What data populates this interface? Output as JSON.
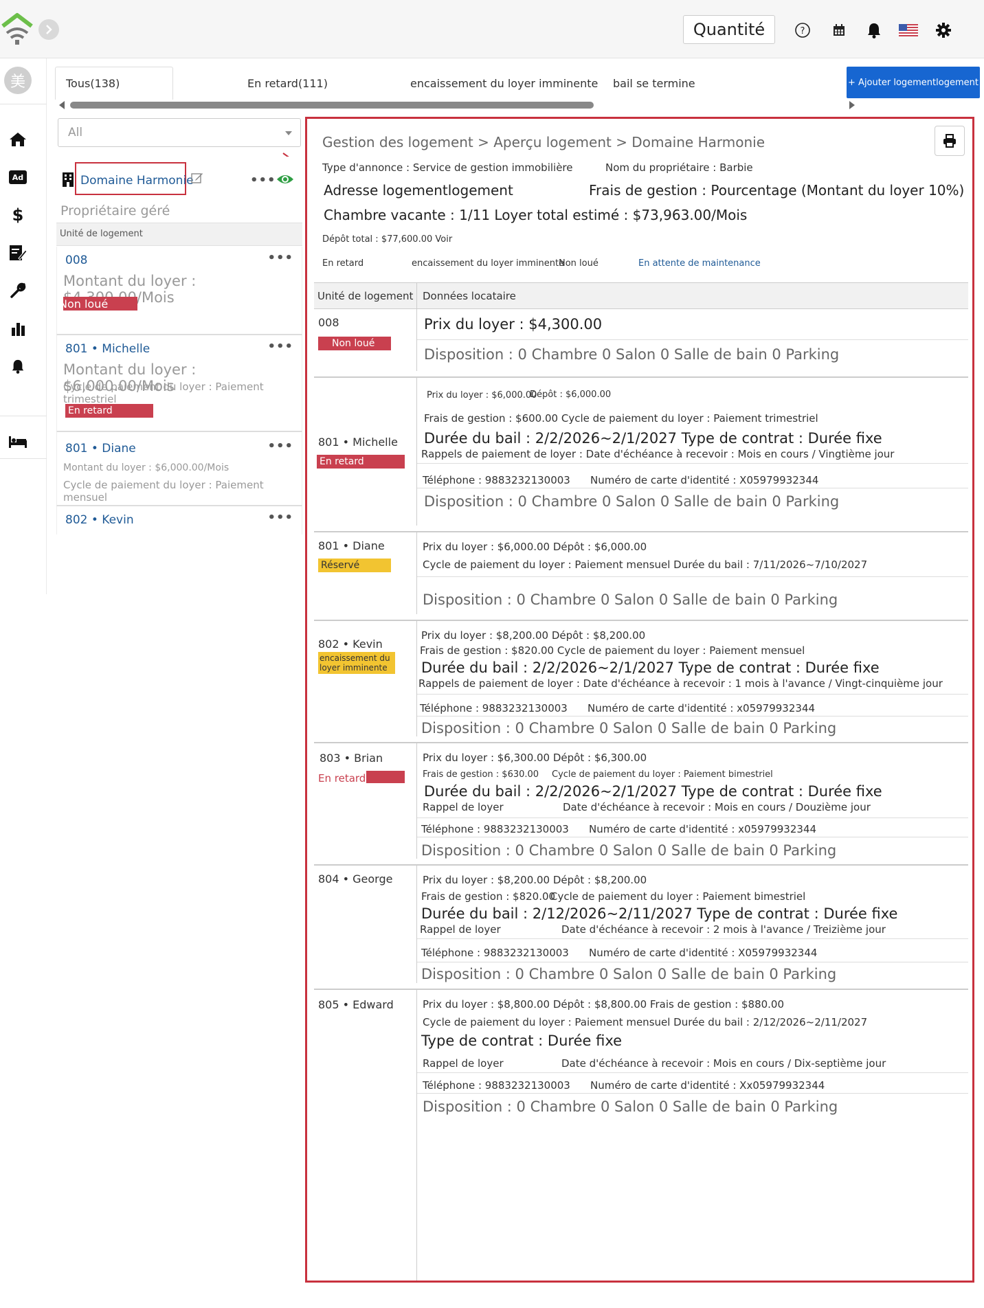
{
  "header": {
    "quantity_label": "Quantité",
    "icons": [
      "logo-house-wifi-icon",
      "chevron-right-icon",
      "help-circle-icon",
      "calendar-icon",
      "bell-icon",
      "us-flag-icon",
      "gear-icon"
    ]
  },
  "sidebar": {
    "avatar_text": "美",
    "icons": [
      "home-icon",
      "ad-icon",
      "dollar-icon",
      "contract-edit-icon",
      "wrench-icon",
      "bar-chart-icon",
      "bell-icon",
      "bed-icon"
    ]
  },
  "tabs": [
    "Tous(138)",
    "En retard(111)",
    "encaissement du loyer imminente",
    "bail se termine"
  ],
  "add_button_label": "+ Ajouter logementlogement",
  "filter_select": {
    "value": "All"
  },
  "property": {
    "name": "Domaine Harmonie",
    "managed_label": "Propriétaire géré",
    "units_header": "Unité de logement"
  },
  "left_units": [
    {
      "title": "008",
      "line1": "Montant du loyer : $4,300.00/Mois",
      "status": "Non loué"
    },
    {
      "title": "801 • Michelle",
      "line1": "Montant du loyer : $6,000.00/Mois",
      "line2": "Cycle de paiement du loyer : Paiement trimestriel",
      "status": "En retard"
    },
    {
      "title": "801 • Diane",
      "line1": "Montant du loyer : $6,000.00/Mois",
      "line2": "Cycle de paiement du loyer : Paiement mensuel"
    },
    {
      "title": "802 • Kevin"
    }
  ],
  "detail": {
    "breadcrumb": "Gestion des logement > Aperçu logement > Domaine Harmonie",
    "listing_type": "Type d'annonce : Service de gestion immobilière",
    "owner_name": "Nom du propriétaire : Barbie",
    "address": "Adresse logementlogement",
    "management_fee": "Frais de gestion : Pourcentage (Montant du loyer 10%)",
    "vacancy": "Chambre vacante : 1/11 Loyer total estimé : $73,963.00/Mois",
    "deposit_total": "Dépôt total : $77,600.00 Voir",
    "legend": [
      "En retard",
      "encaissement du loyer imminente",
      "Non loué",
      "En attente de maintenance"
    ],
    "col_unit": "Unité de logement",
    "col_tenant": "Données locataire"
  },
  "rows": [
    {
      "unit": "008",
      "status": "Non loué",
      "l1": "Prix du loyer : $4,300.00",
      "disp": "Disposition : 0 Chambre 0 Salon 0 Salle de bain 0 Parking"
    },
    {
      "unit": "801 • Michelle",
      "status": "En retard",
      "l1": "Prix du loyer : $6,000.00",
      "l1b": "Dépôt : $6,000.00",
      "l2": "Frais de gestion : $600.00 Cycle de paiement du loyer : Paiement trimestriel",
      "l3": "Durée du bail : 2/2/2026~2/1/2027 Type de contrat : Durée fixe",
      "l4": "Rappels de paiement de loyer : Date d'échéance à recevoir : Mois en cours / Vingtième jour",
      "phone": "Téléphone : 9883232130003",
      "id": "Numéro de carte d'identité : X05979932344",
      "disp": "Disposition : 0 Chambre 0 Salon 0 Salle de bain 0 Parking"
    },
    {
      "unit": "801 • Diane",
      "status": "Réservé",
      "l1": "Prix du loyer : $6,000.00 Dépôt : $6,000.00",
      "l2": "Cycle de paiement du loyer : Paiement mensuel Durée du bail : 7/11/2026~7/10/2027",
      "disp": "Disposition : 0 Chambre 0 Salon 0 Salle de bain 0 Parking"
    },
    {
      "unit": "802 • Kevin",
      "status": "encaissement du loyer imminente",
      "l1": "Prix du loyer : $8,200.00 Dépôt : $8,200.00",
      "l2": "Frais de gestion : $820.00 Cycle de paiement du loyer : Paiement mensuel",
      "l3": "Durée du bail : 2/2/2026~2/1/2027 Type de contrat : Durée fixe",
      "l4": "Rappels de paiement de loyer : Date d'échéance à recevoir : 1 mois à l'avance / Vingt-cinquième jour",
      "phone": "Téléphone : 9883232130003",
      "id": "Numéro de carte d'identité : x05979932344",
      "disp": "Disposition : 0 Chambre 0 Salon 0 Salle de bain 0 Parking"
    },
    {
      "unit": "803 • Brian",
      "status": "En retard",
      "l1": "Prix du loyer : $6,300.00 Dépôt : $6,300.00",
      "l2": "Frais de gestion : $630.00",
      "l2b": "Cycle de paiement du loyer : Paiement bimestriel",
      "l3": "Durée du bail : 2/2/2026~2/1/2027 Type de contrat : Durée fixe",
      "l4": "Rappel de loyer",
      "l4b": "Date d'échéance à recevoir : Mois en cours / Douzième jour",
      "phone": "Téléphone : 9883232130003",
      "id": "Numéro de carte d'identité : x05979932344",
      "disp": "Disposition : 0 Chambre 0 Salon 0 Salle de bain 0 Parking"
    },
    {
      "unit": "804 • George",
      "l1": "Prix du loyer : $8,200.00 Dépôt : $8,200.00",
      "l2": "Frais de gestion : $820.00",
      "l2b": "Cycle de paiement du loyer : Paiement bimestriel",
      "l3": "Durée du bail : 2/12/2026~2/11/2027 Type de contrat : Durée fixe",
      "l4": "Rappel de loyer",
      "l4b": "Date d'échéance à recevoir : 2 mois à l'avance / Treizième jour",
      "phone": "Téléphone : 9883232130003",
      "id": "Numéro de carte d'identité : X05979932344",
      "disp": "Disposition : 0 Chambre 0 Salon 0 Salle de bain 0 Parking"
    },
    {
      "unit": "805 • Edward",
      "l1": "Prix du loyer : $8,800.00 Dépôt : $8,800.00 Frais de gestion : $880.00",
      "l2": "Cycle de paiement du loyer : Paiement mensuel Durée du bail : 2/12/2026~2/11/2027",
      "l3": "Type de contrat : Durée fixe",
      "l4": "Rappel de loyer",
      "l4b": "Date d'échéance à recevoir : Mois en cours / Dix-septième jour",
      "phone": "Téléphone : 9883232130003",
      "id": "Numéro de carte d'identité : Xx05979932344",
      "disp": "Disposition : 0 Chambre 0 Salon 0 Salle de bain 0 Parking"
    }
  ],
  "colors": {
    "accent": "#1766d1",
    "danger": "#c9404f",
    "warning": "#f2c431",
    "highlight_border": "#c8313e",
    "logo_green": "#6cbf4a"
  }
}
